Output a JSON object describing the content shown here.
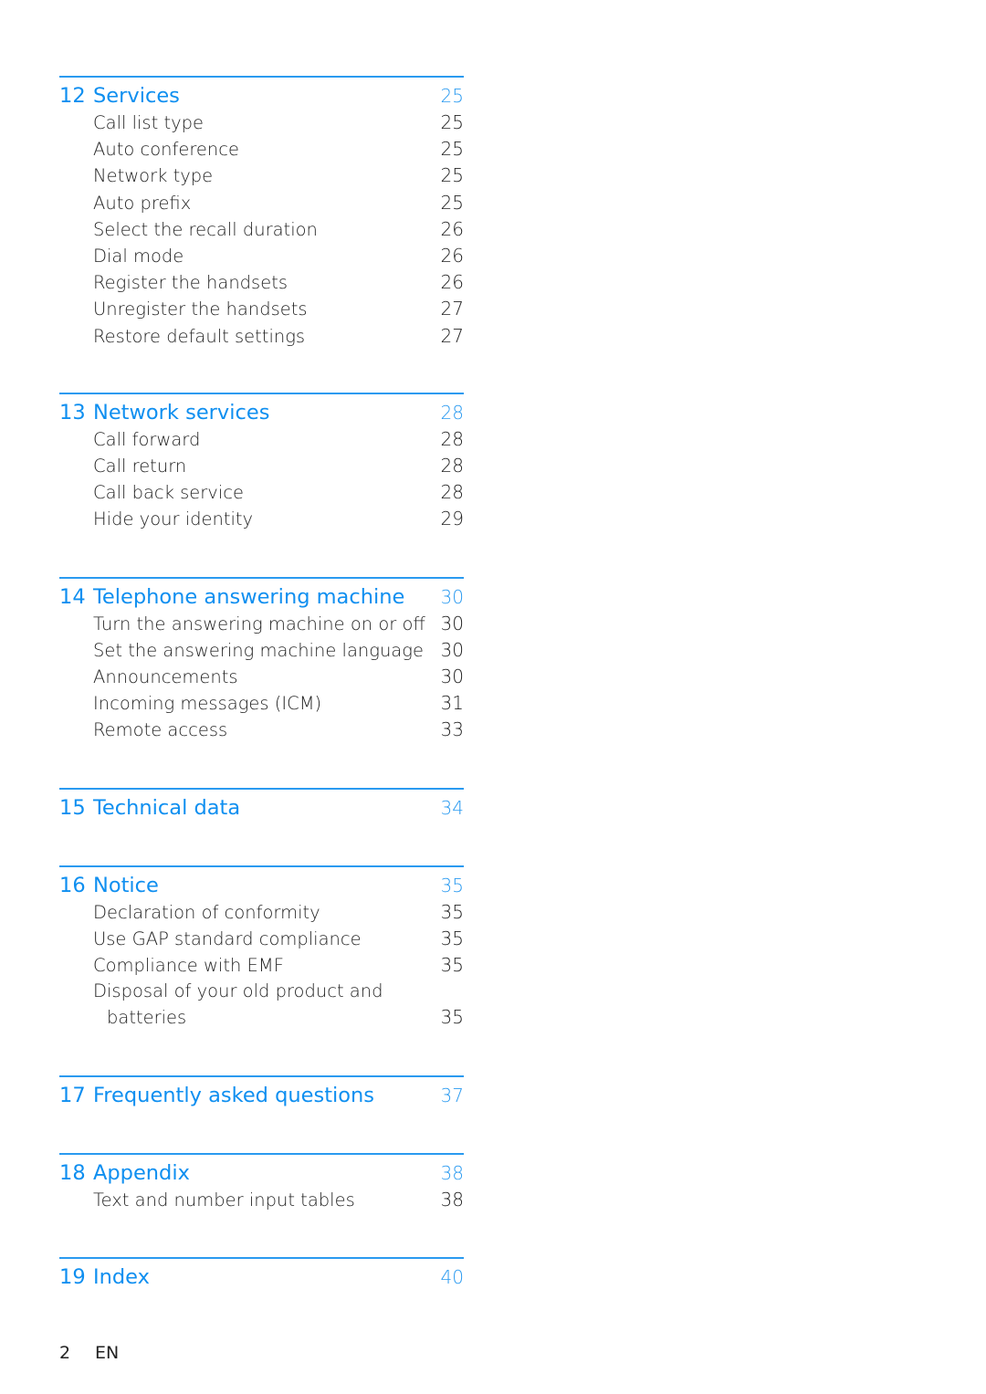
{
  "accent_color": "#0f8ff0",
  "sections": [
    {
      "number": "12",
      "title": "Services",
      "page": "25",
      "entries": [
        {
          "title": "Call list type",
          "page": "25"
        },
        {
          "title": "Auto conference",
          "page": "25"
        },
        {
          "title": "Network type",
          "page": "25"
        },
        {
          "title": "Auto prefix",
          "page": "25"
        },
        {
          "title": "Select the recall duration",
          "page": "26"
        },
        {
          "title": "Dial mode",
          "page": "26"
        },
        {
          "title": "Register the handsets",
          "page": "26"
        },
        {
          "title": "Unregister the handsets",
          "page": "27"
        },
        {
          "title": "Restore default settings",
          "page": "27"
        }
      ]
    },
    {
      "number": "13",
      "title": "Network services",
      "page": "28",
      "entries": [
        {
          "title": "Call forward",
          "page": "28"
        },
        {
          "title": "Call return",
          "page": "28"
        },
        {
          "title": "Call back service",
          "page": "28"
        },
        {
          "title": "Hide your identity",
          "page": "29"
        }
      ]
    },
    {
      "number": "14",
      "title": "Telephone answering machine",
      "page": "30",
      "entries": [
        {
          "title": "Turn the answering machine on or off",
          "page": "30"
        },
        {
          "title": "Set the answering machine language",
          "page": "30"
        },
        {
          "title": "Announcements",
          "page": "30"
        },
        {
          "title": "Incoming messages (ICM)",
          "page": "31"
        },
        {
          "title": "Remote access",
          "page": "33"
        }
      ]
    },
    {
      "number": "15",
      "title": "Technical data",
      "page": "34",
      "entries": []
    },
    {
      "number": "16",
      "title": "Notice",
      "page": "35",
      "entries": [
        {
          "title": "Declaration of conformity",
          "page": "35"
        },
        {
          "title": "Use GAP standard compliance",
          "page": "35"
        },
        {
          "title": "Compliance with EMF",
          "page": "35"
        },
        {
          "title": "Disposal of your old product and",
          "continuation": "batteries",
          "page": "35"
        }
      ]
    },
    {
      "number": "17",
      "title": "Frequently asked questions",
      "page": "37",
      "entries": []
    },
    {
      "number": "18",
      "title": "Appendix",
      "page": "38",
      "entries": [
        {
          "title": "Text and number input tables",
          "page": "38"
        }
      ]
    },
    {
      "number": "19",
      "title": "Index",
      "page": "40",
      "entries": []
    }
  ],
  "footer": {
    "page_number": "2",
    "language": "EN"
  }
}
